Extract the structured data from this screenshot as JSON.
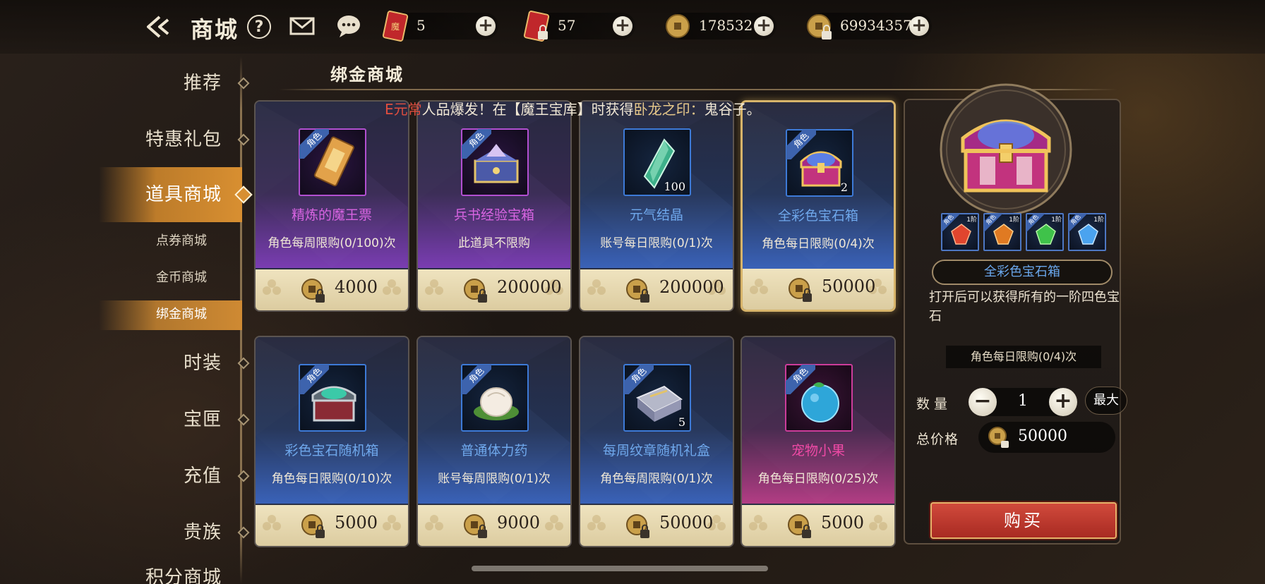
{
  "header": {
    "title": "商城",
    "help_label": "?",
    "resources": [
      {
        "name": "ticket",
        "value": "5",
        "icon": "red-ticket-icon"
      },
      {
        "name": "bound-ticket",
        "value": "57",
        "icon": "locked-red-ticket-icon"
      },
      {
        "name": "gold",
        "value": "178532",
        "icon": "gold-coin-icon"
      },
      {
        "name": "bound-gold",
        "value": "69934357",
        "icon": "locked-gold-coin-icon"
      }
    ]
  },
  "nav": {
    "items": [
      {
        "label": "推荐",
        "active": false
      },
      {
        "label": "特惠礼包",
        "active": false
      },
      {
        "label": "道具商城",
        "active": true
      },
      {
        "label": "点券商城",
        "sub": true
      },
      {
        "label": "金币商城",
        "sub": true
      },
      {
        "label": "绑金商城",
        "sub": true,
        "active": true
      },
      {
        "label": "时装",
        "active": false
      },
      {
        "label": "宝匣",
        "active": false
      },
      {
        "label": "充值",
        "active": false
      },
      {
        "label": "贵族",
        "active": false
      },
      {
        "label": "积分商城",
        "active": false
      }
    ]
  },
  "section": {
    "title": "绑金商城"
  },
  "marquee": {
    "prefix": "E元常",
    "mid1": "人品爆发！在【魔王宝库】时获得",
    "item": "卧龙之印：",
    "suffix": "鬼谷子。"
  },
  "items": [
    {
      "name": "精炼的魔王票",
      "limit": "角色每周限购(0/100)次",
      "price": "4000",
      "qty": "",
      "tag": "角色",
      "rarity": "purple",
      "icon": "demon-ticket-icon"
    },
    {
      "name": "兵书经验宝箱",
      "limit": "此道具不限购",
      "price": "200000",
      "qty": "",
      "tag": "角色",
      "rarity": "purple",
      "icon": "book-chest-icon"
    },
    {
      "name": "元气结晶",
      "limit": "账号每日限购(0/1)次",
      "price": "200000",
      "qty": "100",
      "tag": "",
      "rarity": "blue",
      "icon": "crystal-icon"
    },
    {
      "name": "全彩色宝石箱",
      "limit": "角色每日限购(0/4)次",
      "price": "50000",
      "qty": "2",
      "tag": "角色",
      "rarity": "blue",
      "icon": "gem-chest-icon",
      "selected": true
    },
    {
      "name": "彩色宝石随机箱",
      "limit": "角色每日限购(0/10)次",
      "price": "5000",
      "qty": "",
      "tag": "角色",
      "rarity": "blue",
      "icon": "random-gem-chest-icon"
    },
    {
      "name": "普通体力药",
      "limit": "账号每周限购(0/1)次",
      "price": "9000",
      "qty": "",
      "tag": "角色",
      "rarity": "blue",
      "icon": "stamina-bun-icon"
    },
    {
      "name": "每周纹章随机礼盒",
      "limit": "角色每周限购(0/1)次",
      "price": "50000",
      "qty": "5",
      "tag": "角色",
      "rarity": "blue",
      "icon": "emblem-box-icon"
    },
    {
      "name": "宠物小果",
      "limit": "角色每日限购(0/25)次",
      "price": "5000",
      "qty": "",
      "tag": "角色",
      "rarity": "pink",
      "icon": "pet-fruit-icon"
    }
  ],
  "detail": {
    "name": "全彩色宝石箱",
    "description": "打开后可以获得所有的一阶四色宝石",
    "limit": "角色每日限购(0/4)次",
    "quantity_label": "数量",
    "quantity": "1",
    "max_label": "最大",
    "total_label": "总价格",
    "total": "50000",
    "buy_label": "购买",
    "gems": [
      {
        "tag": "角色",
        "level": "1阶",
        "color": "#e0452e"
      },
      {
        "tag": "角色",
        "level": "1阶",
        "color": "#e07a22"
      },
      {
        "tag": "角色",
        "level": "1阶",
        "color": "#3fc24a"
      },
      {
        "tag": "角色",
        "level": "1阶",
        "color": "#4aa3ef"
      }
    ]
  },
  "colors": {
    "purple": "#d864e2",
    "blue": "#6fa8ec",
    "pink": "#f04aa6",
    "accent": "#d88f31"
  }
}
